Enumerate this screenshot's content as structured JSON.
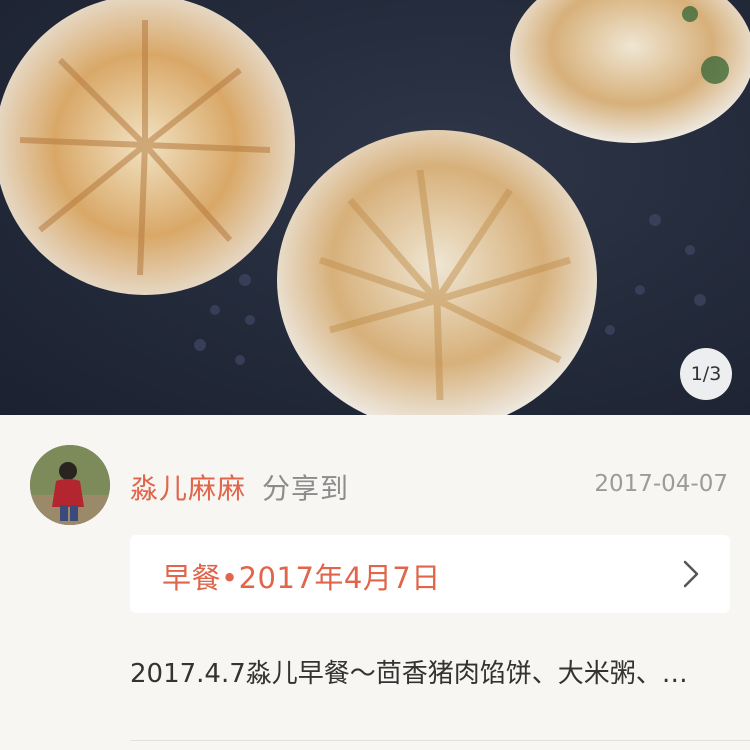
{
  "photo": {
    "counter": "1/3"
  },
  "post": {
    "author": "淼儿麻麻",
    "share_label": "分享到",
    "date": "2017-04-07",
    "album_label": "早餐•2017年4月7日",
    "description": "2017.4.7淼儿早餐～茴香猪肉馅饼、大米粥、…"
  },
  "colors": {
    "accent": "#e0654a",
    "muted_text": "#8c8c8c",
    "background": "#f7f6f3"
  },
  "icons": {
    "album_arrow": "chevron-right-icon"
  }
}
